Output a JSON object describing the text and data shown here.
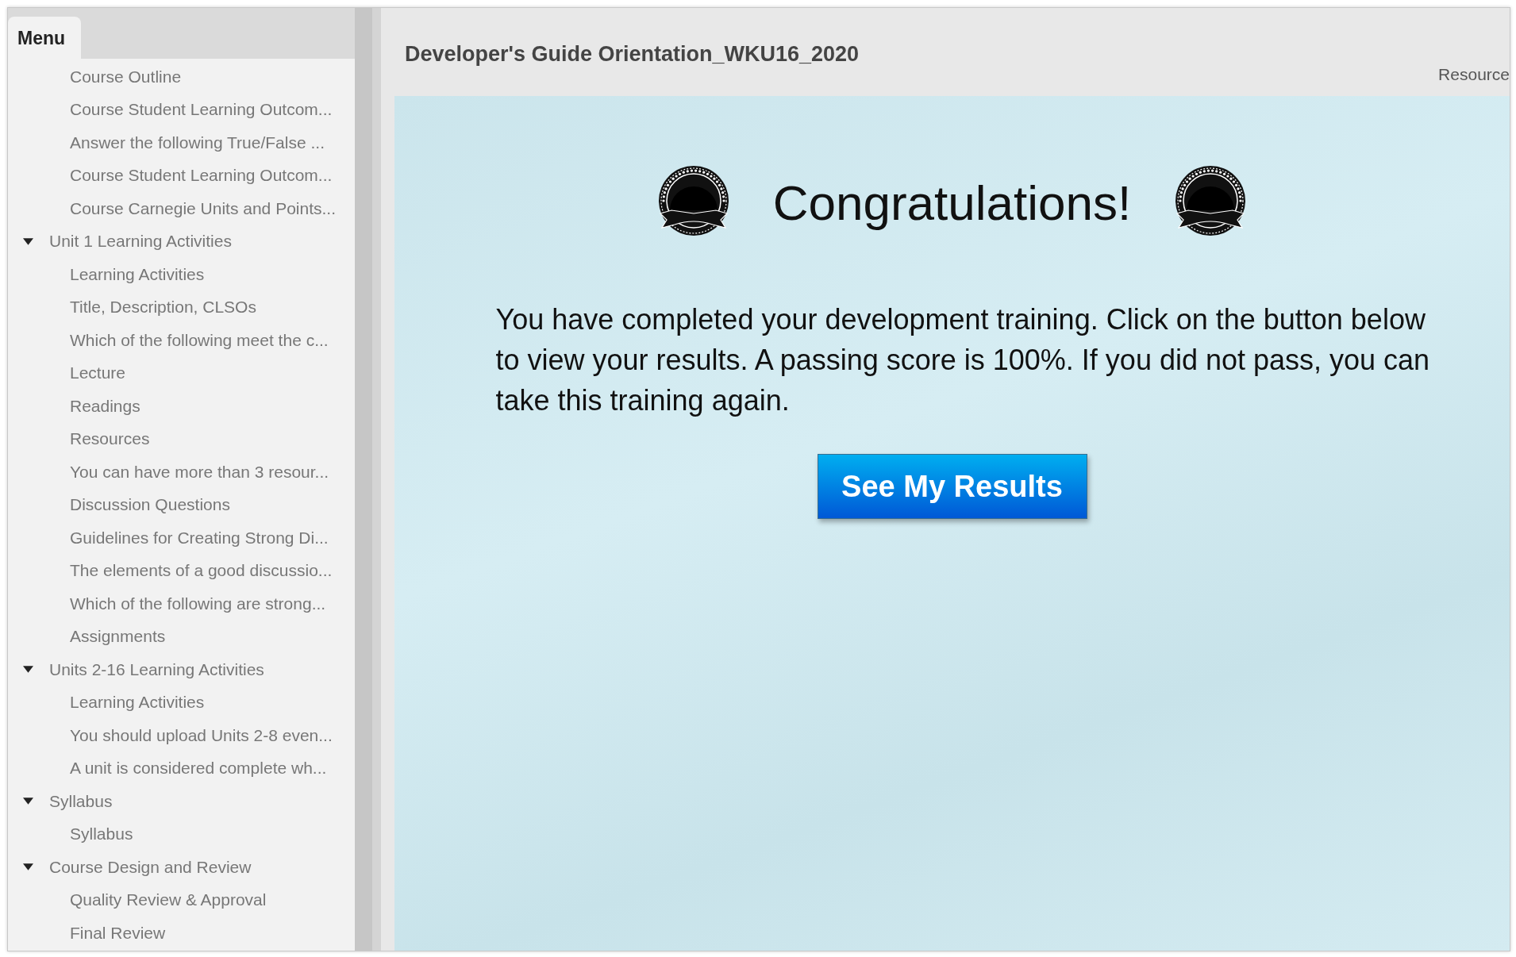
{
  "sidebar": {
    "tab": "Menu",
    "items": [
      {
        "label": "Course Outline"
      },
      {
        "label": "Course Student Learning Outcom..."
      },
      {
        "label": "Answer the following True/False ..."
      },
      {
        "label": "Course Student Learning Outcom..."
      },
      {
        "label": "Course Carnegie Units and Points..."
      },
      {
        "label": "Unit 1 Learning Activities",
        "expanded": true,
        "children": [
          {
            "label": "Learning Activities"
          },
          {
            "label": "Title, Description, CLSOs"
          },
          {
            "label": "Which of the following meet the c..."
          },
          {
            "label": "Lecture"
          },
          {
            "label": "Readings"
          },
          {
            "label": "Resources"
          },
          {
            "label": "You can have more than 3 resour..."
          },
          {
            "label": "Discussion Questions"
          },
          {
            "label": "Guidelines for Creating Strong Di..."
          },
          {
            "label": "The elements of a good discussio..."
          },
          {
            "label": "Which of the following are strong..."
          },
          {
            "label": "Assignments"
          }
        ]
      },
      {
        "label": "Units 2-16 Learning Activities",
        "expanded": true,
        "children": [
          {
            "label": "Learning Activities"
          },
          {
            "label": "You should upload Units 2-8 even..."
          },
          {
            "label": "A unit is considered complete wh..."
          }
        ]
      },
      {
        "label": "Syllabus",
        "expanded": true,
        "children": [
          {
            "label": "Syllabus"
          }
        ]
      },
      {
        "label": "Course Design and Review",
        "expanded": true,
        "children": [
          {
            "label": "Quality Review & Approval"
          },
          {
            "label": "Final Review"
          }
        ]
      }
    ]
  },
  "header": {
    "title": "Developer's Guide Orientation_WKU16_2020",
    "link": "Resource"
  },
  "slide": {
    "heading": "Congratulations!",
    "message": "You have completed your development training. Click on the button below to view your results. A passing score is 100%. If you did not pass, you can take this training again.",
    "button": "See My Results"
  }
}
